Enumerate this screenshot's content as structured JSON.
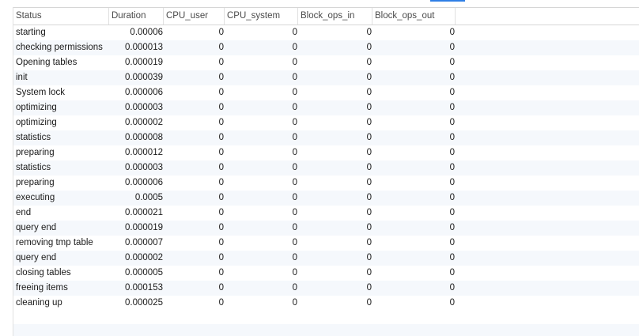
{
  "table": {
    "columns": [
      "Status",
      "Duration",
      "CPU_user",
      "CPU_system",
      "Block_ops_in",
      "Block_ops_out"
    ],
    "rows": [
      [
        "starting",
        "0.00006",
        "0",
        "0",
        "0",
        "0"
      ],
      [
        "checking permissions",
        "0.000013",
        "0",
        "0",
        "0",
        "0"
      ],
      [
        "Opening tables",
        "0.000019",
        "0",
        "0",
        "0",
        "0"
      ],
      [
        "init",
        "0.000039",
        "0",
        "0",
        "0",
        "0"
      ],
      [
        "System lock",
        "0.000006",
        "0",
        "0",
        "0",
        "0"
      ],
      [
        "optimizing",
        "0.000003",
        "0",
        "0",
        "0",
        "0"
      ],
      [
        "optimizing",
        "0.000002",
        "0",
        "0",
        "0",
        "0"
      ],
      [
        "statistics",
        "0.000008",
        "0",
        "0",
        "0",
        "0"
      ],
      [
        "preparing",
        "0.000012",
        "0",
        "0",
        "0",
        "0"
      ],
      [
        "statistics",
        "0.000003",
        "0",
        "0",
        "0",
        "0"
      ],
      [
        "preparing",
        "0.000006",
        "0",
        "0",
        "0",
        "0"
      ],
      [
        "executing",
        "0.0005",
        "0",
        "0",
        "0",
        "0"
      ],
      [
        "end",
        "0.000021",
        "0",
        "0",
        "0",
        "0"
      ],
      [
        "query end",
        "0.000019",
        "0",
        "0",
        "0",
        "0"
      ],
      [
        "removing tmp table",
        "0.000007",
        "0",
        "0",
        "0",
        "0"
      ],
      [
        "query end",
        "0.000002",
        "0",
        "0",
        "0",
        "0"
      ],
      [
        "closing tables",
        "0.000005",
        "0",
        "0",
        "0",
        "0"
      ],
      [
        "freeing items",
        "0.000153",
        "0",
        "0",
        "0",
        "0"
      ],
      [
        "cleaning up",
        "0.000025",
        "0",
        "0",
        "0",
        "0"
      ]
    ]
  },
  "colors": {
    "header_border": "#d6d6d6",
    "alt_row": "#f5f8fc",
    "accent": "#2f7fe6"
  }
}
